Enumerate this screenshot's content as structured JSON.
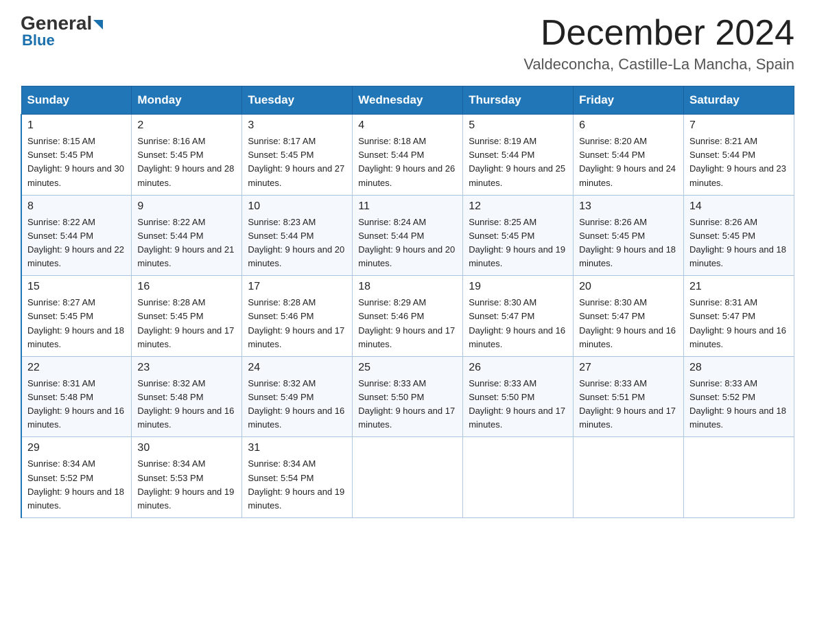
{
  "header": {
    "logo_text": "General",
    "logo_blue": "Blue",
    "month_title": "December 2024",
    "location": "Valdeconcha, Castille-La Mancha, Spain"
  },
  "weekdays": [
    "Sunday",
    "Monday",
    "Tuesday",
    "Wednesday",
    "Thursday",
    "Friday",
    "Saturday"
  ],
  "weeks": [
    [
      {
        "day": "1",
        "sunrise": "8:15 AM",
        "sunset": "5:45 PM",
        "daylight": "9 hours and 30 minutes."
      },
      {
        "day": "2",
        "sunrise": "8:16 AM",
        "sunset": "5:45 PM",
        "daylight": "9 hours and 28 minutes."
      },
      {
        "day": "3",
        "sunrise": "8:17 AM",
        "sunset": "5:45 PM",
        "daylight": "9 hours and 27 minutes."
      },
      {
        "day": "4",
        "sunrise": "8:18 AM",
        "sunset": "5:44 PM",
        "daylight": "9 hours and 26 minutes."
      },
      {
        "day": "5",
        "sunrise": "8:19 AM",
        "sunset": "5:44 PM",
        "daylight": "9 hours and 25 minutes."
      },
      {
        "day": "6",
        "sunrise": "8:20 AM",
        "sunset": "5:44 PM",
        "daylight": "9 hours and 24 minutes."
      },
      {
        "day": "7",
        "sunrise": "8:21 AM",
        "sunset": "5:44 PM",
        "daylight": "9 hours and 23 minutes."
      }
    ],
    [
      {
        "day": "8",
        "sunrise": "8:22 AM",
        "sunset": "5:44 PM",
        "daylight": "9 hours and 22 minutes."
      },
      {
        "day": "9",
        "sunrise": "8:22 AM",
        "sunset": "5:44 PM",
        "daylight": "9 hours and 21 minutes."
      },
      {
        "day": "10",
        "sunrise": "8:23 AM",
        "sunset": "5:44 PM",
        "daylight": "9 hours and 20 minutes."
      },
      {
        "day": "11",
        "sunrise": "8:24 AM",
        "sunset": "5:44 PM",
        "daylight": "9 hours and 20 minutes."
      },
      {
        "day": "12",
        "sunrise": "8:25 AM",
        "sunset": "5:45 PM",
        "daylight": "9 hours and 19 minutes."
      },
      {
        "day": "13",
        "sunrise": "8:26 AM",
        "sunset": "5:45 PM",
        "daylight": "9 hours and 18 minutes."
      },
      {
        "day": "14",
        "sunrise": "8:26 AM",
        "sunset": "5:45 PM",
        "daylight": "9 hours and 18 minutes."
      }
    ],
    [
      {
        "day": "15",
        "sunrise": "8:27 AM",
        "sunset": "5:45 PM",
        "daylight": "9 hours and 18 minutes."
      },
      {
        "day": "16",
        "sunrise": "8:28 AM",
        "sunset": "5:45 PM",
        "daylight": "9 hours and 17 minutes."
      },
      {
        "day": "17",
        "sunrise": "8:28 AM",
        "sunset": "5:46 PM",
        "daylight": "9 hours and 17 minutes."
      },
      {
        "day": "18",
        "sunrise": "8:29 AM",
        "sunset": "5:46 PM",
        "daylight": "9 hours and 17 minutes."
      },
      {
        "day": "19",
        "sunrise": "8:30 AM",
        "sunset": "5:47 PM",
        "daylight": "9 hours and 16 minutes."
      },
      {
        "day": "20",
        "sunrise": "8:30 AM",
        "sunset": "5:47 PM",
        "daylight": "9 hours and 16 minutes."
      },
      {
        "day": "21",
        "sunrise": "8:31 AM",
        "sunset": "5:47 PM",
        "daylight": "9 hours and 16 minutes."
      }
    ],
    [
      {
        "day": "22",
        "sunrise": "8:31 AM",
        "sunset": "5:48 PM",
        "daylight": "9 hours and 16 minutes."
      },
      {
        "day": "23",
        "sunrise": "8:32 AM",
        "sunset": "5:48 PM",
        "daylight": "9 hours and 16 minutes."
      },
      {
        "day": "24",
        "sunrise": "8:32 AM",
        "sunset": "5:49 PM",
        "daylight": "9 hours and 16 minutes."
      },
      {
        "day": "25",
        "sunrise": "8:33 AM",
        "sunset": "5:50 PM",
        "daylight": "9 hours and 17 minutes."
      },
      {
        "day": "26",
        "sunrise": "8:33 AM",
        "sunset": "5:50 PM",
        "daylight": "9 hours and 17 minutes."
      },
      {
        "day": "27",
        "sunrise": "8:33 AM",
        "sunset": "5:51 PM",
        "daylight": "9 hours and 17 minutes."
      },
      {
        "day": "28",
        "sunrise": "8:33 AM",
        "sunset": "5:52 PM",
        "daylight": "9 hours and 18 minutes."
      }
    ],
    [
      {
        "day": "29",
        "sunrise": "8:34 AM",
        "sunset": "5:52 PM",
        "daylight": "9 hours and 18 minutes."
      },
      {
        "day": "30",
        "sunrise": "8:34 AM",
        "sunset": "5:53 PM",
        "daylight": "9 hours and 19 minutes."
      },
      {
        "day": "31",
        "sunrise": "8:34 AM",
        "sunset": "5:54 PM",
        "daylight": "9 hours and 19 minutes."
      },
      null,
      null,
      null,
      null
    ]
  ]
}
